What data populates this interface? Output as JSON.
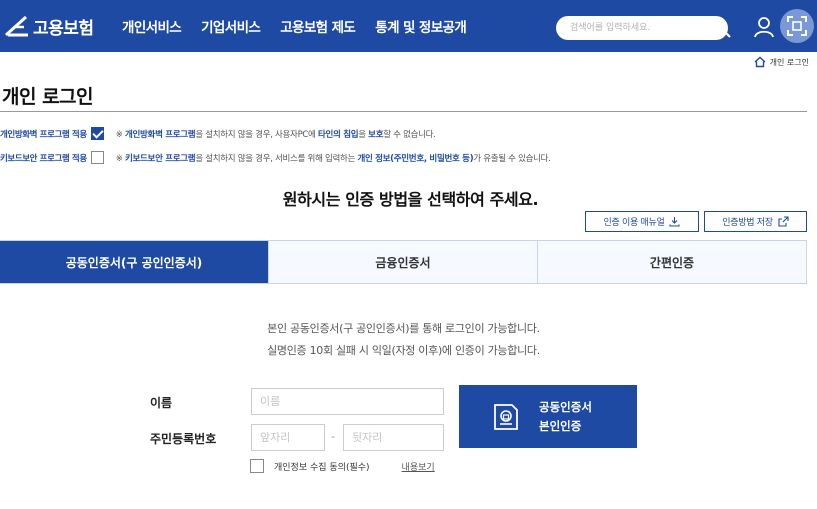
{
  "header": {
    "logo_text": "고용보험",
    "nav": [
      "개인서비스",
      "기업서비스",
      "고용보험 제도",
      "통계 및 정보공개"
    ],
    "search_placeholder": "검색어를 입력하세요."
  },
  "breadcrumb": {
    "current": "개인 로그인"
  },
  "page_title": "개인 로그인",
  "security": [
    {
      "label": "개인방화벽 프로그램 적용",
      "checked": true,
      "note_prefix": "※ ",
      "note_hl1": "개인방화벽 프로그램",
      "note_mid1": "을 설치하지 않을 경우, 사용자PC에 ",
      "note_hl2": "타인의 침입",
      "note_mid2": "을 ",
      "note_hl3": "보호",
      "note_suffix": "할 수 없습니다."
    },
    {
      "label": "키보드보안 프로그램 적용",
      "checked": false,
      "note_prefix": "※ ",
      "note_hl1": "키보드보안 프로그램",
      "note_mid1": "을 설치하지 않을 경우, 서비스를 위해 입력하는 ",
      "note_hl2": "개인 정보(주민번호, 비밀번호 등)",
      "note_suffix": "가 유출될 수 있습니다."
    }
  ],
  "guide_text": "원하시는 인증 방법을 선택하여 주세요.",
  "buttons": {
    "manual": "인증 이용 매뉴얼",
    "save_method": "인증방법 저장"
  },
  "tabs": [
    {
      "label": "공동인증서(구 공인인증서)",
      "active": true
    },
    {
      "label": "금융인증서",
      "active": false
    },
    {
      "label": "간편인증",
      "active": false
    }
  ],
  "info_lines": [
    "본인 공동인증서(구 공인인증서)를 통해 로그인이 가능합니다.",
    "실명인증 10회 실패 시 익일(자정 이후)에 인증이 가능합니다."
  ],
  "form": {
    "name_label": "이름",
    "name_placeholder": "이름",
    "rrn_label": "주민등록번호",
    "rrn_front_placeholder": "앞자리",
    "rrn_dash": "-",
    "rrn_back_placeholder": "뒷자리",
    "cert_button_line1": "공동인증서",
    "cert_button_line2": "본인인증",
    "consent_label": "개인정보 수집 동의(필수)",
    "consent_view": "내용보기"
  },
  "colors": {
    "brand": "#1f4aa3"
  },
  "icons": [
    "logo-icon",
    "search-icon",
    "user-icon",
    "scan-icon",
    "home-icon",
    "download-icon",
    "external-link-icon",
    "certificate-icon"
  ]
}
